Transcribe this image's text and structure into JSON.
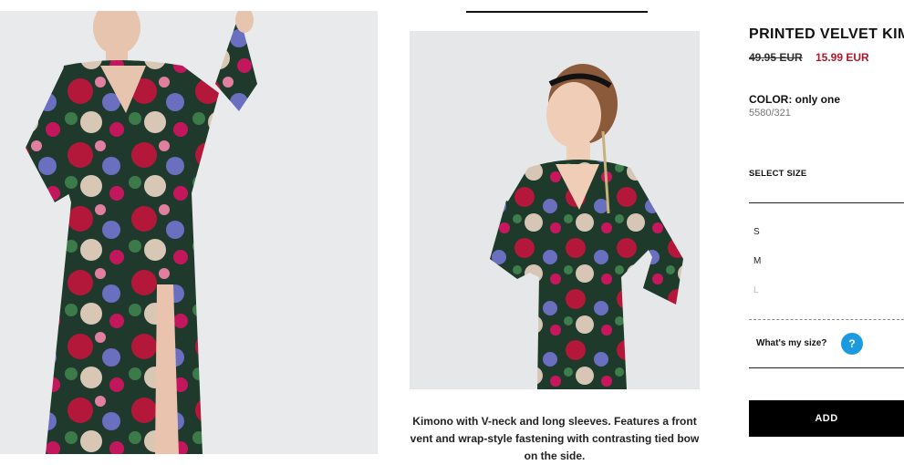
{
  "product": {
    "title": "PRINTED VELVET KIM",
    "price_old": "49.95 EUR",
    "price_new": "15.99 EUR",
    "color_label": "COLOR: only one",
    "reference": "5580/321",
    "description": "Kimono with V-neck and long sleeves. Features a front vent and wrap-style fastening with contrasting tied bow on the side."
  },
  "size_selector": {
    "label": "SELECT SIZE",
    "sizes": [
      "S",
      "M",
      "L"
    ],
    "whats_my_size": "What's my size?",
    "help_glyph": "?"
  },
  "actions": {
    "add_label": "ADD"
  },
  "colors": {
    "sale_red": "#b01728",
    "help_blue": "#1a9be0",
    "button_black": "#000000"
  },
  "images": {
    "left": "model-full-length-velvet-kimono",
    "middle": "model-smiling-velvet-kimono"
  }
}
